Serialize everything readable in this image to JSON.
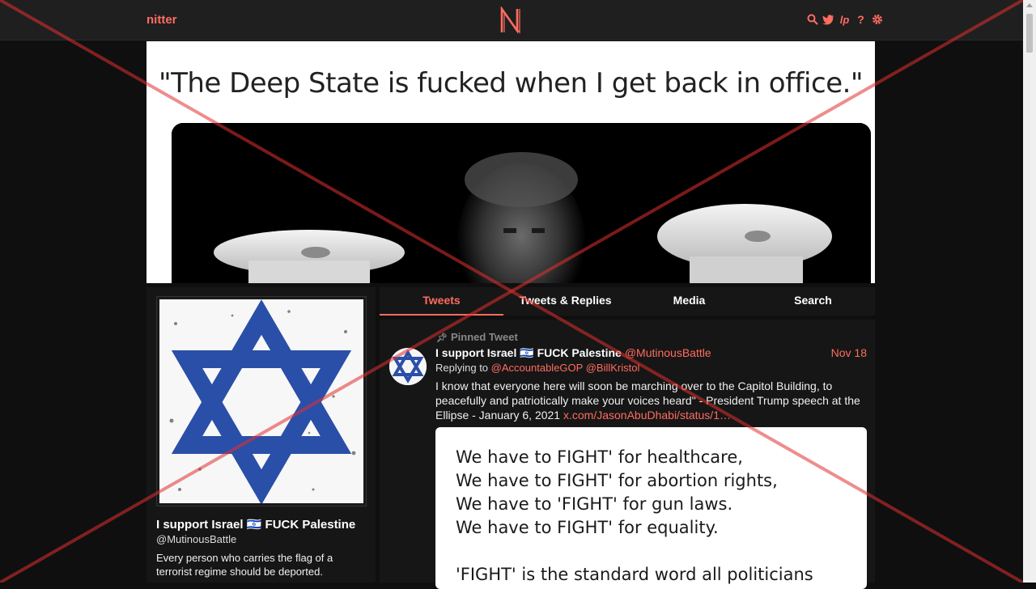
{
  "nav": {
    "brand": "nitter",
    "icons": [
      "search-icon",
      "twitter-icon",
      "liberapay-icon",
      "help-icon",
      "gear-icon"
    ]
  },
  "banner": {
    "quote": "\"The Deep State is fucked when I get back in office.\""
  },
  "profile": {
    "name": "I support Israel 🇮🇱 FUCK Palestine",
    "handle": "@MutinousBattle",
    "bio": "Every person who carries the flag of a terrorist regime should be deported."
  },
  "tabs": [
    "Tweets",
    "Tweets & Replies",
    "Media",
    "Search"
  ],
  "tweet": {
    "pinned_label": "Pinned Tweet",
    "name": "I support Israel 🇮🇱 FUCK Palestine",
    "handle": "@MutinousBattle",
    "date": "Nov 18",
    "replying_label": "Replying to",
    "reply_to_1": "@AccountableGOP",
    "reply_to_2": "@BillKristol",
    "text": "I know that everyone here will soon be marching over to the Capitol Building, to peacefully and patriotically make your voices heard\" - President Trump speech at the Ellipse - January 6, 2021",
    "link": "x.com/JasonAbuDhabi/status/1…",
    "image_lines": [
      "We have to FIGHT' for healthcare,",
      "We have to FIGHT' for abortion rights,",
      "We have to 'FIGHT' for gun laws.",
      "We have to FIGHT' for equality.",
      "",
      "'FIGHT' is the standard word all politicians use"
    ]
  },
  "colors": {
    "accent": "#ff6c60",
    "background": "#0f0f0f",
    "panel": "#161616",
    "star": "#2a4fa8"
  }
}
